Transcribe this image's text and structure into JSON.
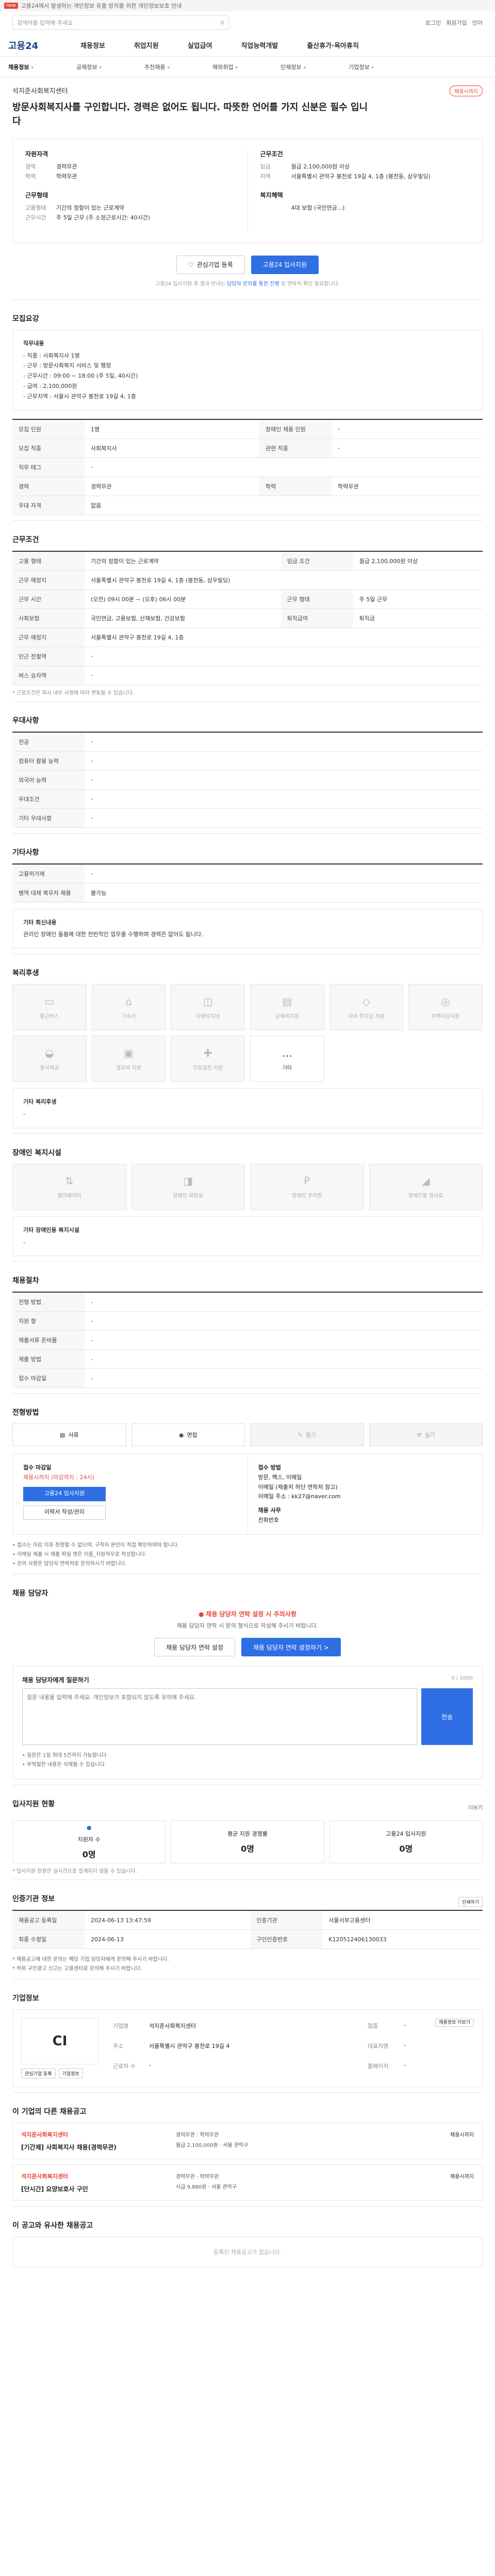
{
  "topbar": {
    "badge": "new",
    "text": "고용24에서 발생하는 개인정보 유출 방지를 위한 개인정보보호 안내"
  },
  "header": {
    "search_placeholder": "검색어를 입력해 주세요",
    "links": [
      "로그인",
      "회원가입",
      "언어"
    ]
  },
  "gnb": {
    "logo": "고용24",
    "items": [
      "채용정보",
      "취업지원",
      "실업급여",
      "직업능력개발",
      "출산휴가·육아휴직"
    ]
  },
  "subnav": [
    "채용정보",
    "공채정보",
    "추천채용",
    "해외취업",
    "인재정보",
    "기업정보"
  ],
  "headline": {
    "company": "석지준사회복지센터",
    "title": "방문사회복지사를 구인합니다. 경력은 없어도 됩니다. 따뜻한 언어를 가지 신분은 필수 입니다",
    "badge": "채용시까지"
  },
  "summary": {
    "col1": [
      {
        "h": "자원자격",
        "rows": [
          [
            "경력",
            "경력무관"
          ],
          [
            "학력",
            "학력무관"
          ]
        ]
      },
      {
        "h": "근무형태",
        "rows": [
          [
            "고용형태",
            "기간의 정함이 있는 근로계약"
          ],
          [
            "근무시간",
            "주 5일 근무 (주 소정근로시간: 40시간)"
          ]
        ]
      }
    ],
    "col2": [
      {
        "h": "근무조건",
        "rows": [
          [
            "임금",
            "월급 2,100,000원 이상"
          ],
          [
            "지역",
            "서울특별시 관악구 봉천로 19길 4, 1층 (봉천동, 삼우빌딩)"
          ]
        ]
      },
      {
        "h": "복지혜택",
        "rows": [
          [
            "",
            "4대 보험 (국민연금...)"
          ]
        ]
      }
    ]
  },
  "actions": {
    "interest": "관심기업 등록",
    "apply": "고용24 입사지원",
    "note_pre": "고용24 입사지원 후 결과 안내는",
    "note_em": "담당자 문의를 통한 진행",
    "note_post": "및 연락처 확인 필요합니다."
  },
  "recruit": {
    "title": "모집요강",
    "box_head": "직무내용",
    "box_lines": [
      "- 직종 : 사회복지사 1명",
      "- 근무 : 방문사회복지 서비스 및 행정",
      "- 근무시간 : 09:00 ~ 18:00 (주 5일, 40시간)",
      "- 급여 : 2,100,000원",
      "- 근무지역 : 서울시 관악구 봉천로 19길 4, 1층"
    ],
    "rows": [
      [
        "모집 인원",
        "1명",
        "장애인 채용 인원",
        "-"
      ],
      [
        "모집 직종",
        "사회복지사",
        "관련 직종",
        "-"
      ],
      [
        "직무 태그",
        "-",
        "",
        ""
      ],
      [
        "경력",
        "경력무관",
        "학력",
        "학력무관"
      ],
      [
        "우대 자격",
        "없음",
        "",
        ""
      ]
    ]
  },
  "conditions": {
    "title": "근무조건",
    "rows": [
      [
        "고용 형태",
        "기간의 정함이 있는 근로계약",
        "임금 조건",
        "월급 2,100,000원 이상"
      ],
      [
        "근무 예정지",
        "서울특별시 관악구 봉천로 19길 4, 1층 (봉천동, 삼우빌딩)",
        "",
        ""
      ],
      [
        "근무 시간",
        "(오전) 09시 00분 ~ (오후) 06시 00분",
        "근무 형태",
        "주 5일 근무"
      ],
      [
        "사회보험",
        "국민연금, 고용보험, 산재보험, 건강보험",
        "퇴직급여",
        "퇴직금"
      ],
      [
        "근무 예정지",
        "서울특별시 관악구 봉천로 19길 4, 1층",
        "",
        ""
      ],
      [
        "인근 전철역",
        "-",
        "",
        ""
      ],
      [
        "버스 승차역",
        "-",
        "",
        ""
      ]
    ],
    "footnote": "* 근로조건은 회사 내부 사정에 따라 변동될 수 있습니다."
  },
  "prefer": {
    "title": "우대사항",
    "rows": [
      [
        "전공",
        "-"
      ],
      [
        "컴퓨터 활용 능력",
        "-"
      ],
      [
        "외국어 능력",
        "-"
      ],
      [
        "우대조건",
        "-"
      ],
      [
        "기타 우대사항",
        "-"
      ]
    ]
  },
  "other": {
    "title": "기타사항",
    "rows": [
      [
        "고용허가제",
        "-"
      ],
      [
        "병역 대체 복무자 채용",
        "불가능"
      ]
    ],
    "box_head": "기타 회신내용",
    "box_text": "관리인 장애인 돌봄에 대한 전반적인 업무를 수행하며 경력은 없어도 됩니다."
  },
  "welfare": {
    "title": "복리후생",
    "items": [
      "통근버스",
      "기숙사",
      "차량유지비",
      "교육비지원",
      "자녀 학자금 지원",
      "주택자금지원",
      "중식제공",
      "경조비 지원",
      "건강검진 지원",
      "기타"
    ],
    "etc_title": "기타 복리후생",
    "etc_value": "-"
  },
  "disability": {
    "title": "장애인 복지시설",
    "items": [
      "엘리베이터",
      "장애인 화장실",
      "장애인 주차장",
      "장애인용 경사로"
    ],
    "etc_title": "기타 장애인용 복지시설",
    "etc_value": "-"
  },
  "process": {
    "title": "채용절차",
    "rows": [
      [
        "전형 방법",
        "-"
      ],
      [
        "지원 형",
        "-"
      ],
      [
        "제출서류 준비물",
        "-"
      ],
      [
        "제출 방법",
        "-"
      ],
      [
        "접수 마감일",
        "-"
      ]
    ]
  },
  "apply": {
    "title": "전형방법",
    "methods": [
      "서류",
      "면접",
      "필기",
      "실기"
    ],
    "period_label": "접수 마감일",
    "period_value": "채용시까지 (마감까지 : 24시)",
    "apply_btn": "고용24 입사지원",
    "manage_btn": "이력서 작성/관리",
    "contact_label": "접수 방법",
    "contact_lines": [
      "방문, 팩스, 이메일",
      "이메일 (제출처 하단 연락처 참고)",
      "이메일 주소 : kk27@naver.com"
    ],
    "manager_label": "채용 사무",
    "manager_value": "전화번호",
    "notices": [
      "• 접수는 마감 이후 정정할 수 없으며, 구직자 본인이 직접 확인하여야 합니다.",
      "• 이메일 제출 시 제출 파일 명은 이름_지원직무로 작성합니다.",
      "• 문의 사항은 담당자 연락처로 문의하시기 바랍니다."
    ]
  },
  "qa": {
    "title": "채용 담당자",
    "alert": "채용 담당자 연락 설정 시 주의사항",
    "desc": "채용 담당자 연락 시 문의 형식으로 작성해 주시기 바랍니다.",
    "btn1": "채용 담당자 연락 설정",
    "btn2": "채용 담당자 연락 설정하기 >",
    "form_label": "채용 담당자에게 질문하기",
    "counter": "0 / 1000",
    "placeholder": "질문 내용을 입력해 주세요. 개인정보가 포함되지 않도록 유의해 주세요.",
    "send": "전송",
    "footnotes": [
      "• 질문은 1일 최대 5건까지 가능합니다.",
      "• 부적절한 내용은 삭제될 수 있습니다."
    ]
  },
  "stats": {
    "title": "입사지원 현황",
    "more": "더보기",
    "items": [
      {
        "label": "지원자 수",
        "num": "0명"
      },
      {
        "label": "평균 지원 경쟁률",
        "num": "0명"
      },
      {
        "label": "고용24 입사지원",
        "num": "0명"
      }
    ],
    "note": "* 입사지원 현황은 실시간으로 집계되지 않을 수 있습니다."
  },
  "info": {
    "title": "인증기관 정보",
    "print": "인쇄하기",
    "rows": [
      [
        "채용공고 등록일",
        "2024-06-13 13:47:59",
        "인증기관",
        "서울서부고용센터"
      ],
      [
        "최종 수정일",
        "2024-06-13",
        "구인인증번호",
        "K120512406130033"
      ]
    ],
    "notes": [
      "* 채용공고에 대한 문의는 해당 기업 담당자에게 문의해 주시기 바랍니다.",
      "* 허위 구인광고 신고는 고용센터로 문의해 주시기 바랍니다."
    ]
  },
  "company": {
    "title": "기업정보",
    "logo": "CI",
    "btn1": "관심기업 등록",
    "btn2": "기업정보",
    "rows": [
      [
        "기업명",
        "석지준사회복지센터",
        "업종",
        "-"
      ],
      [
        "주소",
        "서울특별시 관악구 봉천로 19길 4",
        "대표자명",
        "-"
      ],
      [
        "근로자 수",
        "-",
        "홈페이지",
        "-"
      ]
    ],
    "more": "채용정보 더보기"
  },
  "others": {
    "title": "이 기업의 다른 채용공고",
    "items": [
      {
        "company": "석지준사회복지센터",
        "title": "[기간제] 사회복지사 채용(경력무관)",
        "info": [
          "경력무관",
          "학력무관",
          "월급 2,100,000원",
          "서울 관악구"
        ],
        "due": "채용시까지"
      },
      {
        "company": "석지준사회복지센터",
        "title": "[단시간] 요양보호사 구인",
        "info": [
          "경력무관",
          "학력무관",
          "시급 9,860원",
          "서울 관악구"
        ],
        "due": "채용시까지"
      }
    ]
  },
  "recommend": {
    "title": "이 공고와 유사한 채용공고",
    "empty": "등록된 채용공고가 없습니다."
  }
}
